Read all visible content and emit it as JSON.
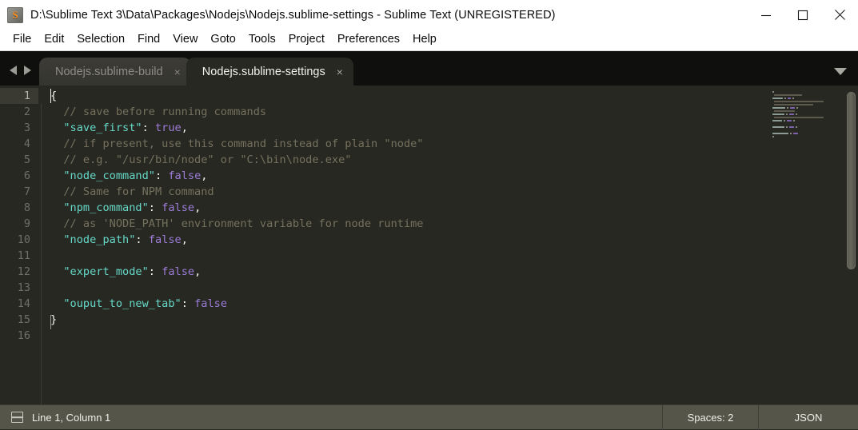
{
  "window": {
    "title": "D:\\Sublime Text 3\\Data\\Packages\\Nodejs\\Nodejs.sublime-settings - Sublime Text (UNREGISTERED)",
    "app_icon": "sublime-text-logo-icon",
    "controls": {
      "minimize": "minimize-icon",
      "maximize": "maximize-icon",
      "close": "close-icon"
    }
  },
  "menubar": {
    "items": [
      {
        "label": "File"
      },
      {
        "label": "Edit"
      },
      {
        "label": "Selection"
      },
      {
        "label": "Find"
      },
      {
        "label": "View"
      },
      {
        "label": "Goto"
      },
      {
        "label": "Tools"
      },
      {
        "label": "Project"
      },
      {
        "label": "Preferences"
      },
      {
        "label": "Help"
      }
    ]
  },
  "tabbar": {
    "nav_prev": "arrow-left-icon",
    "nav_next": "arrow-right-icon",
    "overflow_menu": "chevron-down-icon",
    "close_glyph": "×",
    "tabs": [
      {
        "label": "Nodejs.sublime-build",
        "active": false
      },
      {
        "label": "Nodejs.sublime-settings",
        "active": true
      }
    ]
  },
  "editor": {
    "line_numbers": [
      "1",
      "2",
      "3",
      "4",
      "5",
      "6",
      "7",
      "8",
      "9",
      "10",
      "11",
      "12",
      "13",
      "14",
      "15",
      "16"
    ],
    "current_line": 1,
    "lines": [
      {
        "n": 1,
        "text": "{"
      },
      {
        "n": 2,
        "text": "    // save before running commands"
      },
      {
        "n": 3,
        "text": "    \"save_first\": true,"
      },
      {
        "n": 4,
        "text": "    // if present, use this command instead of plain \"node\""
      },
      {
        "n": 5,
        "text": "    // e.g. \"/usr/bin/node\" or \"C:\\bin\\node.exe\""
      },
      {
        "n": 6,
        "text": "    \"node_command\": false,"
      },
      {
        "n": 7,
        "text": "    // Same for NPM command"
      },
      {
        "n": 8,
        "text": "    \"npm_command\": false,"
      },
      {
        "n": 9,
        "text": "    // as 'NODE_PATH' environment variable for node runtime"
      },
      {
        "n": 10,
        "text": "    \"node_path\": false,"
      },
      {
        "n": 11,
        "text": ""
      },
      {
        "n": 12,
        "text": "    \"expert_mode\": false,"
      },
      {
        "n": 13,
        "text": ""
      },
      {
        "n": 14,
        "text": "    \"ouput_to_new_tab\": false"
      },
      {
        "n": 15,
        "text": "}"
      },
      {
        "n": 16,
        "text": ""
      }
    ],
    "tokens": [
      {
        "n": 1,
        "parts": [
          {
            "t": "{",
            "c": "punct"
          }
        ]
      },
      {
        "n": 2,
        "parts": [
          {
            "t": "  // save before running commands",
            "c": "comment"
          }
        ]
      },
      {
        "n": 3,
        "parts": [
          {
            "t": "  ",
            "c": "punct"
          },
          {
            "t": "\"save_first\"",
            "c": "key"
          },
          {
            "t": ": ",
            "c": "punct"
          },
          {
            "t": "true",
            "c": "const"
          },
          {
            "t": ",",
            "c": "punct"
          }
        ]
      },
      {
        "n": 4,
        "parts": [
          {
            "t": "  // if present, use this command instead of plain \"node\"",
            "c": "comment"
          }
        ]
      },
      {
        "n": 5,
        "parts": [
          {
            "t": "  // e.g. \"/usr/bin/node\" or \"C:\\bin\\node.exe\"",
            "c": "comment"
          }
        ]
      },
      {
        "n": 6,
        "parts": [
          {
            "t": "  ",
            "c": "punct"
          },
          {
            "t": "\"node_command\"",
            "c": "key"
          },
          {
            "t": ": ",
            "c": "punct"
          },
          {
            "t": "false",
            "c": "const"
          },
          {
            "t": ",",
            "c": "punct"
          }
        ]
      },
      {
        "n": 7,
        "parts": [
          {
            "t": "  // Same for NPM command",
            "c": "comment"
          }
        ]
      },
      {
        "n": 8,
        "parts": [
          {
            "t": "  ",
            "c": "punct"
          },
          {
            "t": "\"npm_command\"",
            "c": "key"
          },
          {
            "t": ": ",
            "c": "punct"
          },
          {
            "t": "false",
            "c": "const"
          },
          {
            "t": ",",
            "c": "punct"
          }
        ]
      },
      {
        "n": 9,
        "parts": [
          {
            "t": "  // as 'NODE_PATH' environment variable for node runtime",
            "c": "comment"
          }
        ]
      },
      {
        "n": 10,
        "parts": [
          {
            "t": "  ",
            "c": "punct"
          },
          {
            "t": "\"node_path\"",
            "c": "key"
          },
          {
            "t": ": ",
            "c": "punct"
          },
          {
            "t": "false",
            "c": "const"
          },
          {
            "t": ",",
            "c": "punct"
          }
        ]
      },
      {
        "n": 11,
        "parts": [
          {
            "t": "",
            "c": "punct"
          }
        ]
      },
      {
        "n": 12,
        "parts": [
          {
            "t": "  ",
            "c": "punct"
          },
          {
            "t": "\"expert_mode\"",
            "c": "key"
          },
          {
            "t": ": ",
            "c": "punct"
          },
          {
            "t": "false",
            "c": "const"
          },
          {
            "t": ",",
            "c": "punct"
          }
        ]
      },
      {
        "n": 13,
        "parts": [
          {
            "t": "",
            "c": "punct"
          }
        ]
      },
      {
        "n": 14,
        "parts": [
          {
            "t": "  ",
            "c": "punct"
          },
          {
            "t": "\"ouput_to_new_tab\"",
            "c": "key"
          },
          {
            "t": ": ",
            "c": "punct"
          },
          {
            "t": "false",
            "c": "const"
          }
        ]
      },
      {
        "n": 15,
        "parts": [
          {
            "t": "}",
            "c": "punct"
          }
        ]
      },
      {
        "n": 16,
        "parts": [
          {
            "t": "",
            "c": "punct"
          }
        ]
      }
    ]
  },
  "statusbar": {
    "layout_icon": "split-layout-icon",
    "position": "Line 1, Column 1",
    "indentation": "Spaces: 2",
    "syntax": "JSON"
  },
  "colors": {
    "editor_background": "#272822",
    "titlebar_background": "#ffffff",
    "tabbar_background": "#0f0f0d",
    "statusbar_background": "#555549",
    "comment": "#75715e",
    "key_string": "#66d9c8",
    "constant": "#9d7cd8",
    "foreground": "#f8f8f2",
    "gutter_text": "#6f6f66",
    "current_line_gutter": "#3b3a32",
    "accent_orange": "#ff8c1a"
  }
}
